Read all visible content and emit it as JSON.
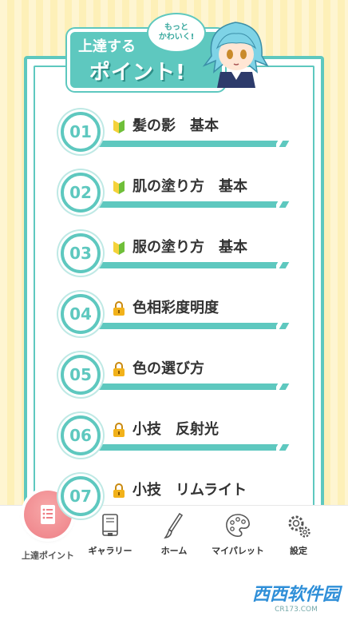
{
  "banner": {
    "line1": "上達する",
    "line2": "ポイント!",
    "bubble_line1": "もっと",
    "bubble_line2": "かわいく!"
  },
  "items": [
    {
      "num": "01",
      "label": "髪の影　基本",
      "icon": "beginner-leaf-icon"
    },
    {
      "num": "02",
      "label": "肌の塗り方　基本",
      "icon": "beginner-leaf-icon"
    },
    {
      "num": "03",
      "label": "服の塗り方　基本",
      "icon": "beginner-leaf-icon"
    },
    {
      "num": "04",
      "label": "色相彩度明度",
      "icon": "lock-icon"
    },
    {
      "num": "05",
      "label": "色の選び方",
      "icon": "lock-icon"
    },
    {
      "num": "06",
      "label": "小技　反射光",
      "icon": "lock-icon"
    },
    {
      "num": "07",
      "label": "小技　リムライト",
      "icon": "lock-icon"
    }
  ],
  "tabs": [
    {
      "label": "上達ポイント",
      "icon": "notes-icon",
      "active": true
    },
    {
      "label": "ギャラリー",
      "icon": "book-icon",
      "active": false
    },
    {
      "label": "ホーム",
      "icon": "brush-icon",
      "active": false
    },
    {
      "label": "マイパレット",
      "icon": "palette-icon",
      "active": false
    },
    {
      "label": "設定",
      "icon": "gear-icon",
      "active": false
    }
  ],
  "watermark": {
    "text": "西西软件园",
    "sub": "CR173.COM"
  },
  "colors": {
    "accent": "#5ec8bf",
    "background": "#fdf0b8",
    "active_tab": "#ee7f86",
    "lock": "#f2b21b",
    "leaf_green": "#6fbf3a",
    "leaf_yellow": "#f4d23a"
  }
}
